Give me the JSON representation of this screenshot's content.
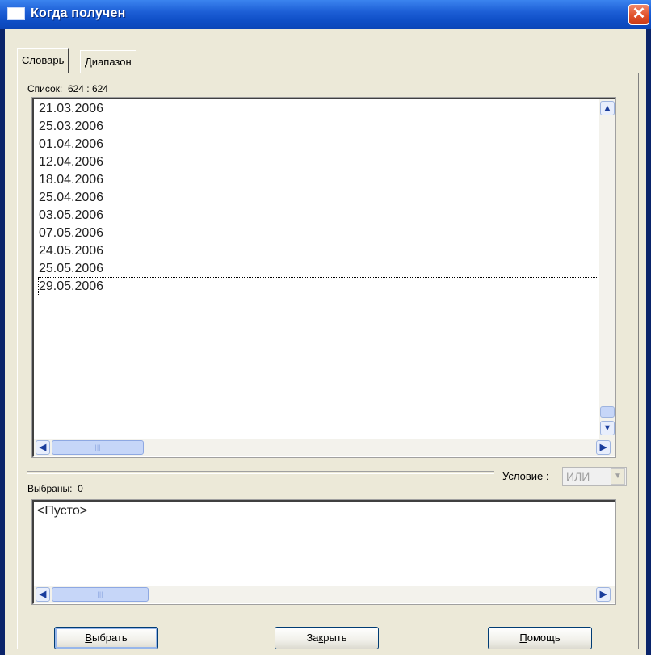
{
  "window": {
    "title": "Когда получен",
    "close_glyph": "✕"
  },
  "tabs": [
    {
      "label": "Словарь",
      "active": true
    },
    {
      "label": "Диапазон",
      "active": false
    }
  ],
  "list": {
    "label": "Список:",
    "count": "624 : 624",
    "items": [
      "21.03.2006",
      "25.03.2006",
      "01.04.2006",
      "12.04.2006",
      "18.04.2006",
      "25.04.2006",
      "03.05.2006",
      "07.05.2006",
      "24.05.2006",
      "25.05.2006",
      "29.05.2006"
    ],
    "focused_index": 10
  },
  "condition": {
    "label": "Условие :",
    "value": "ИЛИ"
  },
  "selected": {
    "label": "Выбраны:",
    "count": "0",
    "empty_text": "<Пусто>"
  },
  "buttons": {
    "select": {
      "pre": "",
      "accel": "В",
      "post": "ыбрать"
    },
    "close": {
      "pre": "За",
      "accel": "к",
      "post": "рыть"
    },
    "help": {
      "pre": "",
      "accel": "П",
      "post": "омощь"
    }
  },
  "icons": {
    "scroll_up": "▲",
    "scroll_down": "▼",
    "scroll_left": "◀",
    "scroll_right": "▶",
    "grip": "|||"
  },
  "colors": {
    "titlebar": "#0b46b8",
    "close": "#e1522b",
    "face": "#ece9d8"
  }
}
